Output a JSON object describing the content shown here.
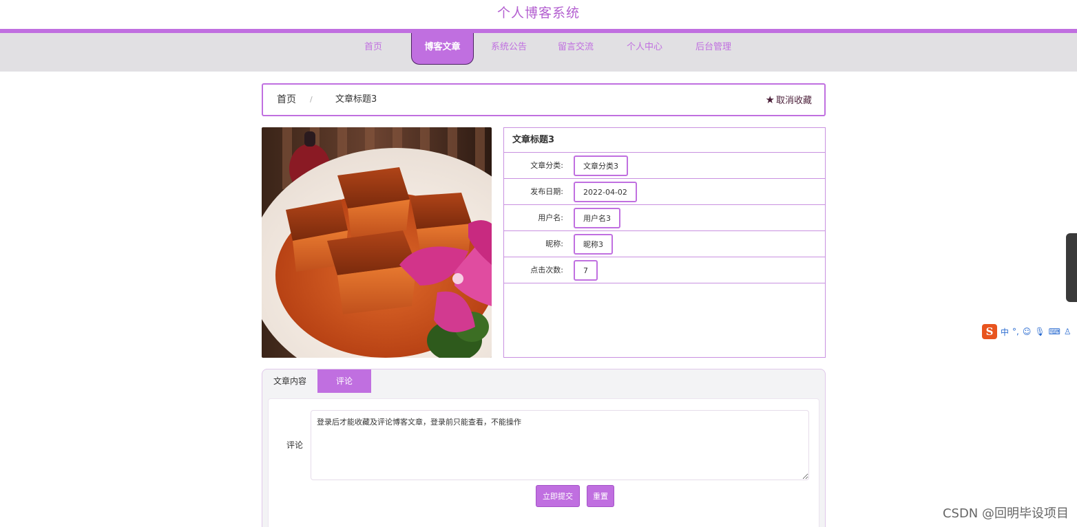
{
  "site": {
    "title": "个人博客系统"
  },
  "nav": {
    "items": [
      {
        "label": "首页"
      },
      {
        "label": "博客文章"
      },
      {
        "label": "系统公告"
      },
      {
        "label": "留言交流"
      },
      {
        "label": "个人中心"
      },
      {
        "label": "后台管理"
      }
    ],
    "active_index": 1
  },
  "breadcrumb": {
    "home": "首页",
    "separator": "/",
    "current": "文章标题3",
    "favorite_label": "取消收藏"
  },
  "article": {
    "title": "文章标题3",
    "fields": [
      {
        "label": "文章分类:",
        "value": "文章分类3"
      },
      {
        "label": "发布日期:",
        "value": "2022-04-02"
      },
      {
        "label": "用户名:",
        "value": "用户名3"
      },
      {
        "label": "昵称:",
        "value": "昵称3"
      },
      {
        "label": "点击次数:",
        "value": "7"
      }
    ]
  },
  "tabs": {
    "content_label": "文章内容",
    "comment_label": "评论"
  },
  "comment_form": {
    "label": "评论",
    "value": "登录后才能收藏及评论博客文章，登录前只能查看，不能操作",
    "submit_label": "立即提交",
    "reset_label": "重置"
  },
  "ime": {
    "logo": "S",
    "items": [
      "中",
      "°,",
      "☺",
      "🎙",
      "⌨",
      "♙"
    ]
  },
  "watermark": "CSDN @回明毕设项目",
  "colors": {
    "accent": "#c06fe0",
    "nav_bg": "#e1e0e3",
    "title": "#b35fd0"
  }
}
